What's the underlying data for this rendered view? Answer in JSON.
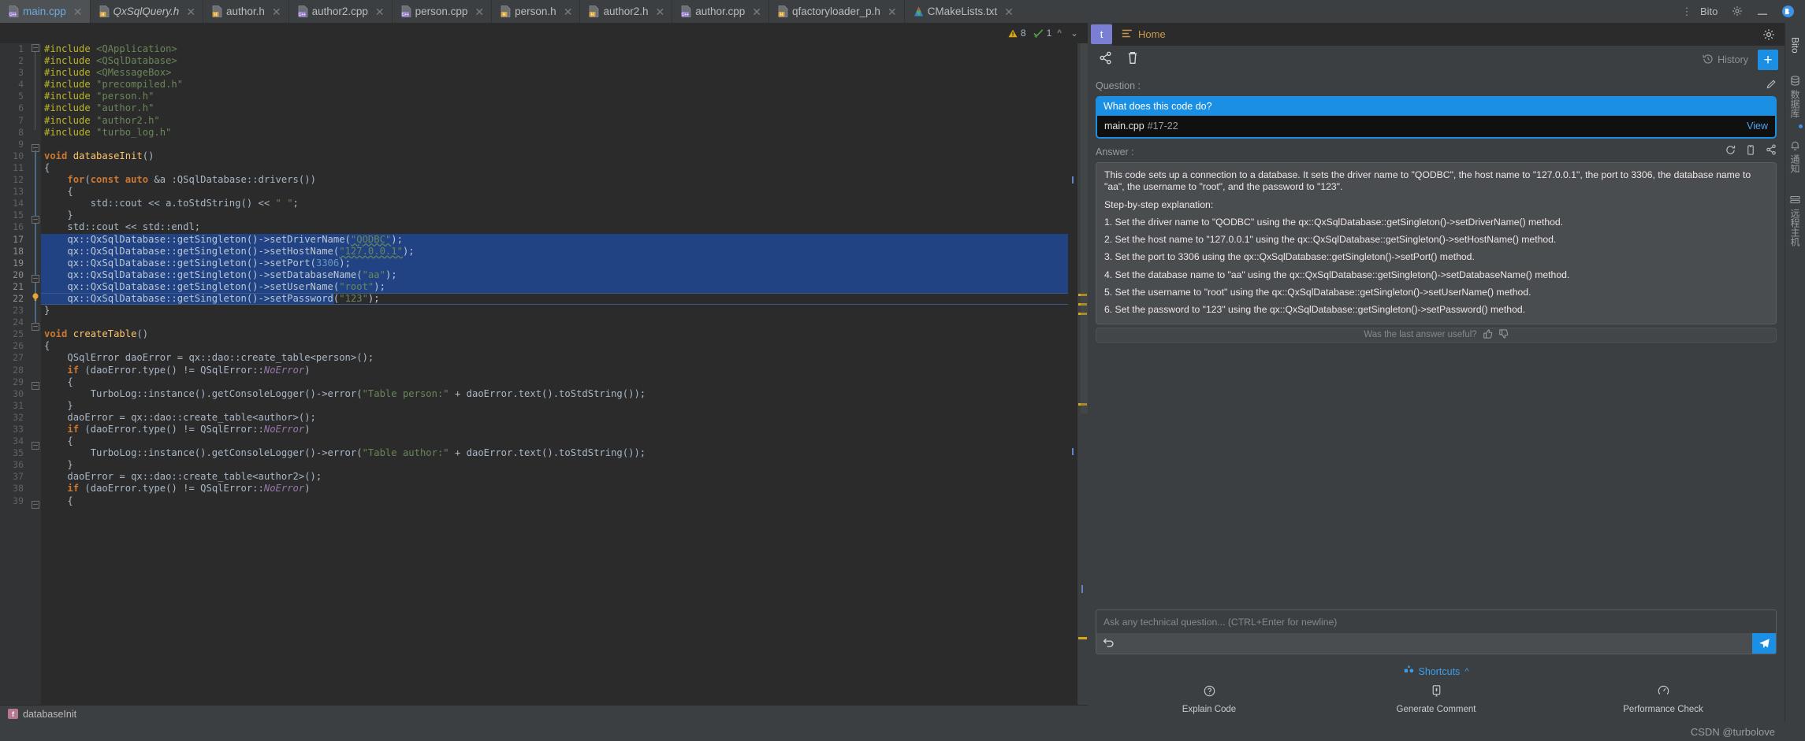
{
  "window": {
    "app_panel_label": "Bito",
    "gear_icon": "gear-icon",
    "minimize_icon": "minimize-icon",
    "bito_circle_icon": "bito-logo-icon"
  },
  "tabs": [
    {
      "label": "main.cpp",
      "icon": "cpp-file-icon",
      "active": true,
      "italic": false
    },
    {
      "label": "QxSqlQuery.h",
      "icon": "header-file-icon",
      "active": false,
      "italic": true
    },
    {
      "label": "author.h",
      "icon": "header-file-icon",
      "active": false,
      "italic": false
    },
    {
      "label": "author2.cpp",
      "icon": "cpp-file-icon",
      "active": false,
      "italic": false
    },
    {
      "label": "person.cpp",
      "icon": "cpp-file-icon",
      "active": false,
      "italic": false
    },
    {
      "label": "person.h",
      "icon": "header-file-icon",
      "active": false,
      "italic": false
    },
    {
      "label": "author2.h",
      "icon": "header-file-icon",
      "active": false,
      "italic": false
    },
    {
      "label": "author.cpp",
      "icon": "cpp-file-icon",
      "active": false,
      "italic": false
    },
    {
      "label": "qfactoryloader_p.h",
      "icon": "header-file-icon",
      "active": false,
      "italic": false
    },
    {
      "label": "CMakeLists.txt",
      "icon": "cmake-file-icon",
      "active": false,
      "italic": false
    }
  ],
  "inspections": {
    "warning_icon": "warning-triangle-icon",
    "warning_count": "8",
    "ok_icon": "inspection-ok-icon",
    "ok_count": "1",
    "prev_icon": "chevron-up-icon",
    "next_icon": "chevron-down-icon"
  },
  "editor": {
    "filename": "main.cpp",
    "selection_start_line": 17,
    "selection_end_line": 22,
    "caret_line": 22,
    "first_line": 1,
    "lines": [
      {
        "n": 1,
        "html": "<span class=\"pp\">#include</span> <span class=\"str\">&lt;QApplication&gt;</span>"
      },
      {
        "n": 2,
        "html": "<span class=\"pp\">#include</span> <span class=\"str\">&lt;QSqlDatabase&gt;</span>"
      },
      {
        "n": 3,
        "html": "<span class=\"pp\">#include</span> <span class=\"str\">&lt;QMessageBox&gt;</span>"
      },
      {
        "n": 4,
        "html": "<span class=\"pp\">#include</span> <span class=\"str\">\"precompiled.h\"</span>"
      },
      {
        "n": 5,
        "html": "<span class=\"pp\">#include</span> <span class=\"str\">\"person.h\"</span>"
      },
      {
        "n": 6,
        "html": "<span class=\"pp\">#include</span> <span class=\"str\">\"author.h\"</span>"
      },
      {
        "n": 7,
        "html": "<span class=\"pp\">#include</span> <span class=\"str\">\"author2.h\"</span>"
      },
      {
        "n": 8,
        "html": "<span class=\"pp\">#include</span> <span class=\"str\">\"turbo_log.h\"</span>"
      },
      {
        "n": 9,
        "html": ""
      },
      {
        "n": 10,
        "html": "<span class=\"k\">void</span> <span class=\"fn\">databaseInit</span><span class=\"tx\">()</span>"
      },
      {
        "n": 11,
        "html": "<span class=\"tx\">{</span>"
      },
      {
        "n": 12,
        "html": "    <span class=\"k\">for</span><span class=\"tx\">(</span><span class=\"k\">const</span> <span class=\"k\">auto</span> <span class=\"tx\">&amp;a :QSqlDatabase::drivers())</span>"
      },
      {
        "n": 13,
        "html": "    <span class=\"tx\">{</span>"
      },
      {
        "n": 14,
        "html": "        <span class=\"tx\">std::cout &lt;&lt; a.toStdString() &lt;&lt; </span><span class=\"str\">\" \"</span><span class=\"tx\">;</span>"
      },
      {
        "n": 15,
        "html": "    <span class=\"tx\">}</span>"
      },
      {
        "n": 16,
        "html": "    <span class=\"tx\">std::cout &lt;&lt; std::endl;</span>"
      },
      {
        "n": 17,
        "html": "    <span class=\"tx\">qx::QxSqlDatabase::getSingleton()-&gt;setDriverName(</span><span class=\"str squig\">\"QODBC\"</span><span class=\"tx\">);</span>"
      },
      {
        "n": 18,
        "html": "    <span class=\"tx\">qx::QxSqlDatabase::getSingleton()-&gt;setHostName(</span><span class=\"str squig\">\"127.0.0.1\"</span><span class=\"tx\">);</span>"
      },
      {
        "n": 19,
        "html": "    <span class=\"tx\">qx::QxSqlDatabase::getSingleton()-&gt;setPort(</span><span class=\"num\">3306</span><span class=\"tx\">);</span>"
      },
      {
        "n": 20,
        "html": "    <span class=\"tx\">qx::QxSqlDatabase::getSingleton()-&gt;setDatabaseName(</span><span class=\"str\">\"aa\"</span><span class=\"tx\">);</span>"
      },
      {
        "n": 21,
        "html": "    <span class=\"tx\">qx::QxSqlDatabase::getSingleton()-&gt;setUserName(</span><span class=\"str\">\"root\"</span><span class=\"tx\">);</span>"
      },
      {
        "n": 22,
        "html": "    <span class=\"tx\">qx::QxSqlDatabase::getSingleton()-&gt;setPassword(</span><span class=\"str\">\"123\"</span><span class=\"tx\">);</span>"
      },
      {
        "n": 23,
        "html": "<span class=\"tx\">}</span>"
      },
      {
        "n": 24,
        "html": ""
      },
      {
        "n": 25,
        "html": "<span class=\"k\">void</span> <span class=\"fn\">createTable</span><span class=\"tx\">()</span>"
      },
      {
        "n": 26,
        "html": "<span class=\"tx\">{</span>"
      },
      {
        "n": 27,
        "html": "    <span class=\"tx\">QSqlError daoError = qx::dao::create_table&lt;person&gt;();</span>"
      },
      {
        "n": 28,
        "html": "    <span class=\"k\">if</span> <span class=\"tx\">(daoError.type() != QSqlError::</span><span class=\"it\">NoError</span><span class=\"tx\">)</span>"
      },
      {
        "n": 29,
        "html": "    <span class=\"tx\">{</span>"
      },
      {
        "n": 30,
        "html": "        <span class=\"tx\">TurboLog::instance().getConsoleLogger()-&gt;error(</span><span class=\"str\">\"Table person:\"</span><span class=\"tx\"> + daoError.text().toStdString());</span>"
      },
      {
        "n": 31,
        "html": "    <span class=\"tx\">}</span>"
      },
      {
        "n": 32,
        "html": "    <span class=\"tx\">daoError = qx::dao::create_table&lt;author&gt;();</span>"
      },
      {
        "n": 33,
        "html": "    <span class=\"k\">if</span> <span class=\"tx\">(daoError.type() != QSqlError::</span><span class=\"it\">NoError</span><span class=\"tx\">)</span>"
      },
      {
        "n": 34,
        "html": "    <span class=\"tx\">{</span>"
      },
      {
        "n": 35,
        "html": "        <span class=\"tx\">TurboLog::instance().getConsoleLogger()-&gt;error(</span><span class=\"str\">\"Table author:\"</span><span class=\"tx\"> + daoError.text().toStdString());</span>"
      },
      {
        "n": 36,
        "html": "    <span class=\"tx\">}</span>"
      },
      {
        "n": 37,
        "html": "    <span class=\"tx\">daoError = qx::dao::create_table&lt;author2&gt;();</span>"
      },
      {
        "n": 38,
        "html": "    <span class=\"k\">if</span> <span class=\"tx\">(daoError.type() != QSqlError::</span><span class=\"it\">NoError</span><span class=\"tx\">)</span>"
      },
      {
        "n": 39,
        "html": "    <span class=\"tx\">{</span>"
      }
    ]
  },
  "breadcrumb": {
    "badge": "f",
    "text": "databaseInit"
  },
  "bito": {
    "avatar_letter": "t",
    "tab_label": "Home",
    "tab_icon": "home-list-icon",
    "settings_icon": "gear-icon",
    "toolbar": {
      "share_icon": "share-icon",
      "delete_icon": "trash-icon",
      "history_icon": "history-icon",
      "history_label": "History",
      "new_chat_label": "+"
    },
    "question": {
      "label": "Question :",
      "edit_icon": "pencil-icon",
      "title": "What does this code do?",
      "file": "main.cpp",
      "line_range": "#17-22",
      "view_label": "View"
    },
    "answer": {
      "label": "Answer :",
      "regenerate_icon": "refresh-icon",
      "copy_icon": "copy-icon",
      "share_icon": "share-icon",
      "paragraphs": [
        "This code sets up a connection to a database. It sets the driver name to \"QODBC\", the host name to \"127.0.0.1\", the port to 3306, the database name to \"aa\", the username to \"root\", and the password to \"123\".",
        " Step-by-step explanation:",
        "1. Set the driver name to \"QODBC\" using the qx::QxSqlDatabase::getSingleton()->setDriverName() method.",
        "2. Set the host name to \"127.0.0.1\" using the qx::QxSqlDatabase::getSingleton()->setHostName() method.",
        "3. Set the port to 3306 using the qx::QxSqlDatabase::getSingleton()->setPort() method.",
        "4. Set the database name to \"aa\" using the qx::QxSqlDatabase::getSingleton()->setDatabaseName() method.",
        "5. Set the username to \"root\" using the qx::QxSqlDatabase::getSingleton()->setUserName() method.",
        "6. Set the password to \"123\" using the qx::QxSqlDatabase::getSingleton()->setPassword() method."
      ]
    },
    "feedback": {
      "text": "Was the last answer useful?",
      "thumbs_up_icon": "thumbs-up-icon",
      "thumbs_down_icon": "thumbs-down-icon"
    },
    "composer": {
      "placeholder": "Ask any technical question... (CTRL+Enter for newline)",
      "value": "",
      "undo_icon": "undo-icon",
      "send_icon": "send-icon"
    },
    "shortcuts": {
      "label": "Shortcuts",
      "icon": "shortcuts-icon",
      "collapse_icon": "chevron-up-icon",
      "items": [
        {
          "label": "Explain Code",
          "icon": "question-circle-icon"
        },
        {
          "label": "Generate Comment",
          "icon": "comment-icon"
        },
        {
          "label": "Performance Check",
          "icon": "speedometer-icon"
        }
      ]
    }
  },
  "right_toolwindows": [
    {
      "label": "Bito",
      "icon": "bito-icon",
      "active": true,
      "badge": false
    },
    {
      "label": "数据库",
      "icon": "database-icon",
      "active": false,
      "badge": false
    },
    {
      "label": "通知",
      "icon": "bell-icon",
      "active": false,
      "badge": true
    },
    {
      "label": "远程主机",
      "icon": "remote-host-icon",
      "active": false,
      "badge": false
    }
  ],
  "status": {
    "watermark": "CSDN @turbolove"
  },
  "colors": {
    "accent_blue": "#1a8fe3",
    "selection_blue": "#214283",
    "editor_bg": "#2b2b2b",
    "panel_bg": "#3c3f41",
    "tab_active": "#4e5254",
    "warning_yellow": "#d9a812",
    "string_green": "#6a8759",
    "keyword_orange": "#cc7832"
  }
}
